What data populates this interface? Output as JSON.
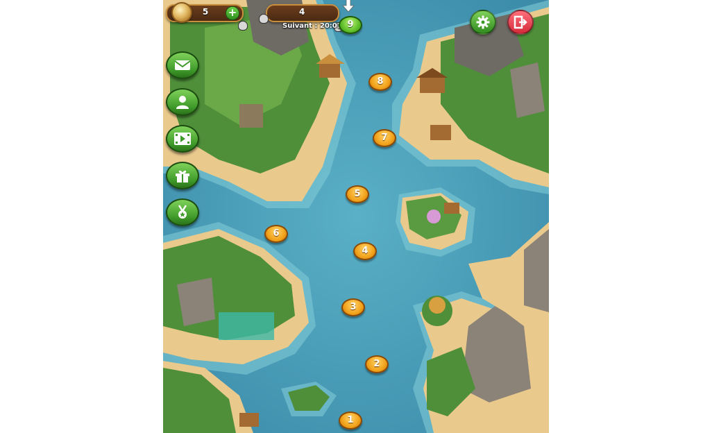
{
  "hud": {
    "coins": "5",
    "add_coins_label": "+",
    "lives": "4",
    "next_life_timer": "Suivant : 20:01"
  },
  "side_menu": {
    "items": [
      {
        "name": "messages",
        "icon": "envelope-icon"
      },
      {
        "name": "profile",
        "icon": "user-icon"
      },
      {
        "name": "video",
        "icon": "film-play-icon"
      },
      {
        "name": "gifts",
        "icon": "gift-icon"
      },
      {
        "name": "achievements",
        "icon": "medal-icon"
      }
    ]
  },
  "top_right": {
    "settings_icon": "gear-icon",
    "exit_icon": "exit-icon"
  },
  "levels": [
    {
      "number": "1",
      "state": "completed"
    },
    {
      "number": "2",
      "state": "completed"
    },
    {
      "number": "3",
      "state": "completed"
    },
    {
      "number": "4",
      "state": "completed"
    },
    {
      "number": "5",
      "state": "completed"
    },
    {
      "number": "6",
      "state": "completed"
    },
    {
      "number": "7",
      "state": "completed"
    },
    {
      "number": "8",
      "state": "completed"
    },
    {
      "number": "9",
      "state": "current"
    }
  ],
  "colors": {
    "sea": "#4a9bb5",
    "level_completed": "#f2a21a",
    "level_current": "#5fbf2a",
    "button_green": "#3f9a2a",
    "button_red": "#d42a3a"
  }
}
